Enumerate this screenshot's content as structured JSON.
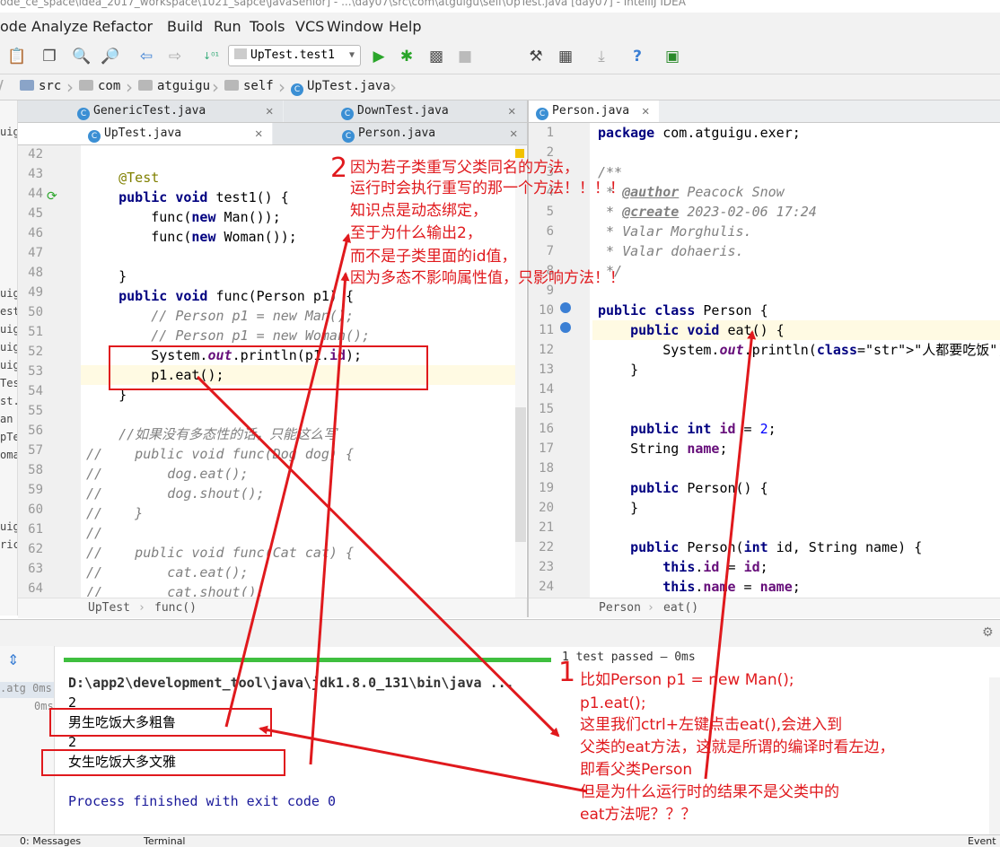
{
  "window": {
    "title": "ode_ce_space\\idea_2017_workspace\\1021_sapce\\JavaSenior] - ...\\day07\\src\\com\\atguigu\\self\\UpTest.java [day07] - IntelliJ IDEA"
  },
  "menu": [
    "ode",
    "Analyze",
    "Refactor",
    "Build",
    "Run",
    "Tools",
    "VCS",
    "Window",
    "Help"
  ],
  "toolbar": {
    "run_config": "UpTest.test1"
  },
  "breadcrumbs": [
    "src",
    "com",
    "atguigu",
    "self",
    "UpTest.java"
  ],
  "left_strip": [
    "uig",
    "est",
    "uig",
    "uig",
    "uig",
    "Tes",
    "st.",
    "an",
    "pTe",
    "oma",
    "",
    "uig",
    "ric"
  ],
  "left_tabs_row1": [
    "GenericTest.java",
    "DownTest.java"
  ],
  "left_tabs_row2": [
    "UpTest.java",
    "Person.java"
  ],
  "right_tabs": [
    "Person.java"
  ],
  "left_editor": {
    "line_numbers": [
      "42",
      "43",
      "44",
      "45",
      "46",
      "47",
      "48",
      "49",
      "50",
      "51",
      "52",
      "53",
      "54",
      "55",
      "56",
      "57",
      "58",
      "59",
      "60",
      "61",
      "62",
      "63",
      "64"
    ],
    "lines": [
      "",
      "    @Test",
      "    public void test1() {",
      "        func(new Man());",
      "        func(new Woman());",
      "",
      "    }",
      "    public void func(Person p1) {",
      "        // Person p1 = new Man();",
      "        // Person p1 = new Woman();",
      "        System.out.println(p1.id);",
      "        p1.eat();",
      "    }",
      "",
      "    //如果没有多态性的话，只能这么写",
      "//    public void func(Dog dog) {",
      "//        dog.eat();",
      "//        dog.shout();",
      "//    }",
      "//",
      "//    public void func(Cat cat) {",
      "//        cat.eat();",
      "//        cat.shout();"
    ],
    "breadcrumb": [
      "UpTest",
      "func()"
    ]
  },
  "right_editor": {
    "line_numbers": [
      "1",
      "2",
      "3",
      "4",
      "5",
      "6",
      "7",
      "8",
      "9",
      "10",
      "11",
      "12",
      "13",
      "14",
      "15",
      "16",
      "17",
      "18",
      "19",
      "20",
      "21",
      "22",
      "23",
      "24"
    ],
    "lines": [
      "package com.atguigu.exer;",
      "",
      "/**",
      " * @author Peacock Snow",
      " * @create 2023-02-06 17:24",
      " * Valar Morghulis.",
      " * Valar dohaeris.",
      " */",
      "",
      "public class Person {",
      "    public void eat() {",
      "        System.out.println(\"人都要吃饭\");",
      "    }",
      "",
      "",
      "    public int id = 2;",
      "    String name;",
      "",
      "    public Person() {",
      "    }",
      "",
      "    public Person(int id, String name) {",
      "        this.id = id;",
      "        this.name = name;"
    ],
    "breadcrumb": [
      "Person",
      "eat()"
    ]
  },
  "run_panel": {
    "progress_fraction": 1.0,
    "status": "1 test passed – 0ms",
    "tree": [
      ".atg 0ms",
      "0ms"
    ],
    "console": [
      "D:\\app2\\development_tool\\java\\jdk1.8.0_131\\bin\\java ...",
      "2",
      "男生吃饭大多粗鲁",
      "2",
      "女生吃饭大多文雅",
      "",
      "Process finished with exit code 0"
    ]
  },
  "bottom_bar": [
    "0: Messages",
    "Terminal",
    "Event"
  ],
  "annotations": {
    "note2_num": "2",
    "note2": [
      "因为若子类重写父类同名的方法，",
      "运行时会执行重写的那一个方法！！！！",
      "知识点是动态绑定，",
      "至于为什么输出2，",
      "而不是子类里面的id值，",
      "因为多态不影响属性值，只影响方法！！"
    ],
    "note1_num": "1",
    "note1": [
      "比如Person p1 = new Man();",
      "p1.eat();",
      "这里我们ctrl+左键点击eat(),会进入到",
      "父类的eat方法，这就是所谓的编译时看左边，",
      "即看父类Person",
      "但是为什么运行时的结果不是父类中的",
      "eat方法呢？？？"
    ]
  },
  "colors": {
    "annotation_red": "#e0191d",
    "keyword": "#000080",
    "string": "#008000",
    "progress_green": "#3fbf3f"
  }
}
